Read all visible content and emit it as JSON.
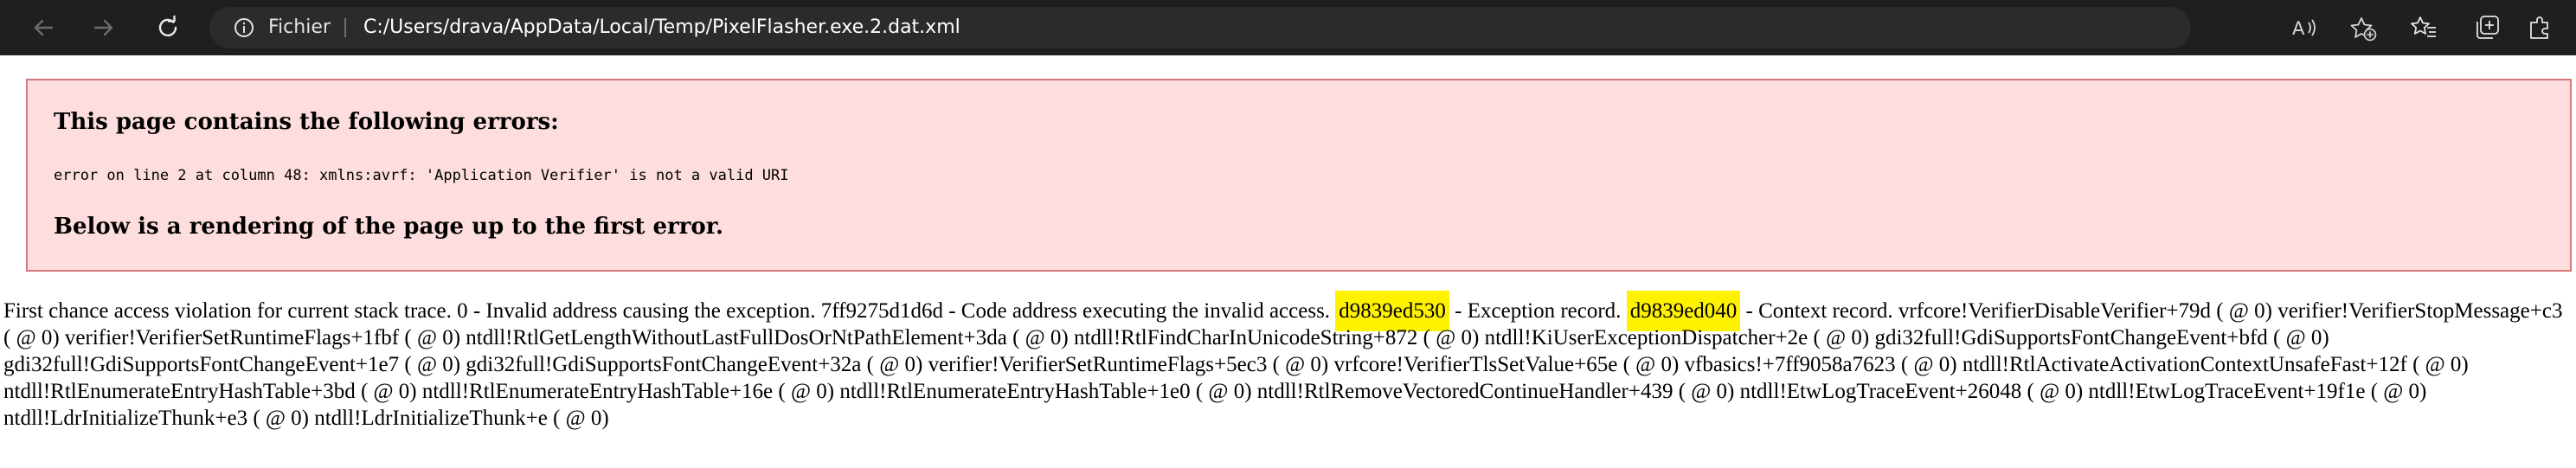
{
  "browser": {
    "site_label": "Fichier",
    "url": "C:/Users/drava/AppData/Local/Temp/PixelFlasher.exe.2.dat.xml",
    "icons": {
      "back": "back-arrow-icon",
      "forward": "forward-arrow-icon",
      "refresh": "refresh-icon",
      "info": "info-icon",
      "read_aloud": "read-aloud-icon",
      "add_favorite": "add-favorite-icon",
      "favorites": "favorites-icon",
      "collections": "collections-icon",
      "extensions": "extensions-icon"
    },
    "colors": {
      "chrome_bg": "#1f1f1f",
      "address_bg": "#2b2b2b"
    }
  },
  "error_box": {
    "title": "This page contains the following errors:",
    "detail": "error on line 2 at column 48: xmlns:avrf: 'Application Verifier' is not a valid URI",
    "footer": "Below is a rendering of the page up to the first error.",
    "colors": {
      "background": "#fddddd",
      "border": "#d57a7a"
    }
  },
  "trace": {
    "part1": "First chance access violation for current stack trace. 0 - Invalid address causing the exception. 7ff9275d1d6d - Code address executing the invalid access.",
    "highlight1": "d9839ed530",
    "part2": " - Exception record.",
    "highlight2": "d9839ed040",
    "part3": " - Context record. vrfcore!VerifierDisableVerifier+79d ( @ 0) verifier!VerifierStopMessage+c3 ( @ 0) verifier!VerifierSetRuntimeFlags+1fbf ( @ 0) ntdll!RtlGetLengthWithoutLastFullDosOrNtPathElement+3da ( @ 0) ntdll!RtlFindCharInUnicodeString+872 ( @ 0) ntdll!KiUserExceptionDispatcher+2e ( @ 0) gdi32full!GdiSupportsFontChangeEvent+bfd ( @ 0) gdi32full!GdiSupportsFontChangeEvent+1e7 ( @ 0) gdi32full!GdiSupportsFontChangeEvent+32a ( @ 0) verifier!VerifierSetRuntimeFlags+5ec3 ( @ 0) vrfcore!VerifierTlsSetValue+65e ( @ 0) vfbasics!+7ff9058a7623 ( @ 0) ntdll!RtlActivateActivationContextUnsafeFast+12f ( @ 0) ntdll!RtlEnumerateEntryHashTable+3bd ( @ 0) ntdll!RtlEnumerateEntryHashTable+16e ( @ 0) ntdll!RtlEnumerateEntryHashTable+1e0 ( @ 0) ntdll!RtlRemoveVectoredContinueHandler+439 ( @ 0) ntdll!EtwLogTraceEvent+26048 ( @ 0) ntdll!EtwLogTraceEvent+19f1e ( @ 0) ntdll!LdrInitializeThunk+e3 ( @ 0) ntdll!LdrInitializeThunk+e ( @ 0)",
    "highlight_color": "#fff200"
  }
}
